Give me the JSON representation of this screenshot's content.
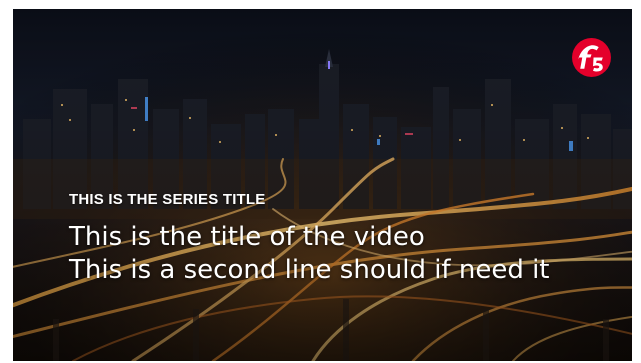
{
  "slide": {
    "series_title": "THIS IS THE SERIES TITLE",
    "title_line_1": "This is the title of the video",
    "title_line_2": "This is a second line should if need it"
  },
  "logo": {
    "text": "f5",
    "color": "#e4002b"
  },
  "background": {
    "description_icon": "city-night-highway-image"
  }
}
